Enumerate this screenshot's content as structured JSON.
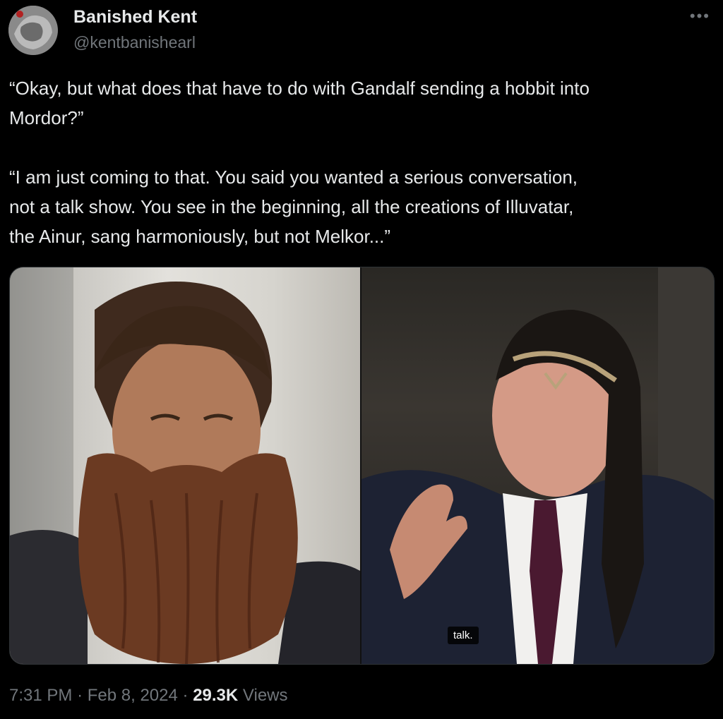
{
  "author": {
    "display_name": "Banished Kent",
    "handle": "@kentbanishearl",
    "avatar_icon": "avatar-icon"
  },
  "more_icon": "more-options-icon",
  "tweet": {
    "text": "“Okay, but what does that have to do with Gandalf sending a hobbit into\nMordor?”\n\n“I am just coming to that. You said you wanted a serious conversation,\nnot a talk show. You see in the beginning, all the creations of Illuvatar,\nthe Ainur, sang harmoniously, but not Melkor...”"
  },
  "media": {
    "caption": "talk."
  },
  "meta": {
    "time": "7:31 PM",
    "separator": "·",
    "date": "Feb 8, 2024",
    "views_count": "29.3K",
    "views_label": "Views"
  },
  "colors": {
    "background": "#000000",
    "text_primary": "#e7e9ea",
    "text_secondary": "#71767b"
  }
}
